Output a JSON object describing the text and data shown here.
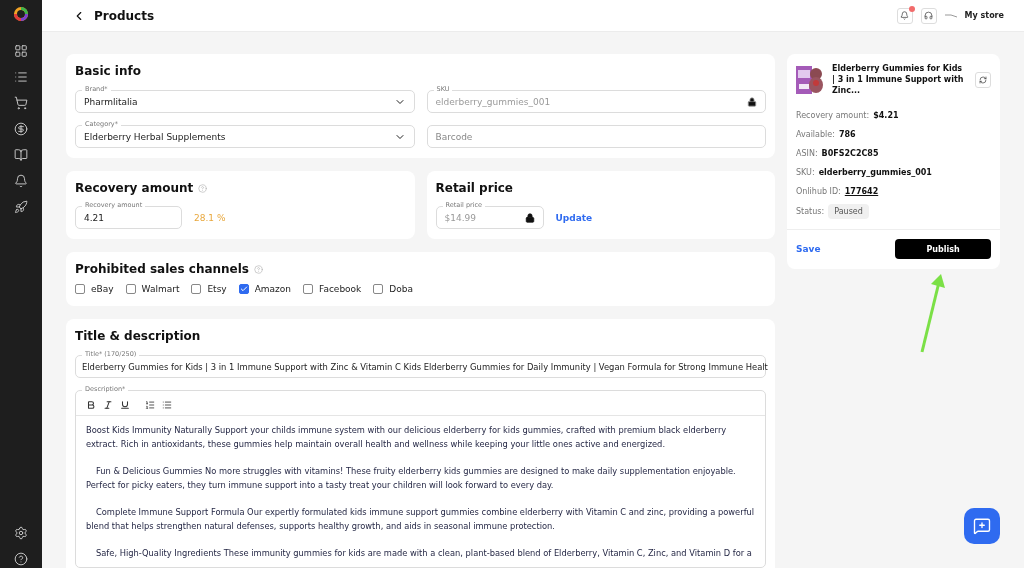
{
  "header": {
    "title": "Products",
    "has_notifications": true,
    "store": "My store"
  },
  "basic_info": {
    "title": "Basic info",
    "fields": [
      {
        "kind": "select",
        "label": "Brand*",
        "value": "Pharmlitalia"
      },
      {
        "kind": "locked",
        "label": "SKU",
        "value": "elderberry_gummies_001"
      },
      {
        "kind": "select",
        "label": "Category*",
        "value": "Elderberry Herbal Supplements"
      },
      {
        "kind": "text",
        "placeholder": "Barcode"
      }
    ]
  },
  "recovery": {
    "title": "Recovery amount",
    "field_label": "Recovery amount",
    "value": "4.21",
    "percent": "28.1 %"
  },
  "retail": {
    "title": "Retail price",
    "field_label": "Retail price",
    "value": "$14.99",
    "link": "Update"
  },
  "prohibited": {
    "title": "Prohibited sales channels",
    "channels": [
      {
        "label": "eBay",
        "checked": false
      },
      {
        "label": "Walmart",
        "checked": false
      },
      {
        "label": "Etsy",
        "checked": false
      },
      {
        "label": "Amazon",
        "checked": true
      },
      {
        "label": "Facebook",
        "checked": false
      },
      {
        "label": "Doba",
        "checked": false
      }
    ]
  },
  "title_description": {
    "title": "Title & description",
    "title_label": "Title* (170/250)",
    "title_value": "Elderberry Gummies for Kids | 3 in 1 Immune Support with Zinc & Vitamin C   Kids Elderberry Gummies for Daily Immunity | Vegan Formula for Strong Immune Healt",
    "description_label": "Description*",
    "paragraphs": [
      "Boost Kids Immunity Naturally Support your childs immune system with our delicious elderberry for kids gummies, crafted with premium black elderberry extract. Rich in antioxidants, these gummies help maintain overall health and wellness while keeping your little ones active and energized.",
      "Fun & Delicious Gummies No more struggles with vitamins! These fruity elderberry kids gummies are designed to make daily supplementation enjoyable. Perfect for picky eaters, they turn immune support into a tasty treat your children will look forward to every day.",
      "Complete Immune Support Formula Our expertly formulated kids immune support gummies combine elderberry with Vitamin C and zinc, providing a powerful blend that helps strengthen natural defenses, supports healthy growth, and aids in seasonal immune protection.",
      "Safe, High-Quality Ingredients These immunity gummies for kids are made with a clean, plant-based blend of Elderberry, Vitamin C, Zinc, and Vitamin D for a"
    ]
  },
  "summary": {
    "title": "Elderberry Gummies for Kids | 3 in 1 Immune Support with Zinc...",
    "details": [
      {
        "kind": "plain",
        "label": "Recovery amount:",
        "value": "$4.21"
      },
      {
        "kind": "plain",
        "label": "Available:",
        "value": "786"
      },
      {
        "kind": "plain",
        "label": "ASIN:",
        "value": "B0FS2C2C85"
      },
      {
        "kind": "plain",
        "label": "SKU:",
        "value": "elderberry_gummies_001"
      },
      {
        "kind": "link",
        "label": "Onlihub ID:",
        "value": "177642"
      },
      {
        "kind": "badge",
        "label": "Status:",
        "value": "Paused"
      }
    ],
    "save": "Save",
    "publish": "Publish"
  }
}
